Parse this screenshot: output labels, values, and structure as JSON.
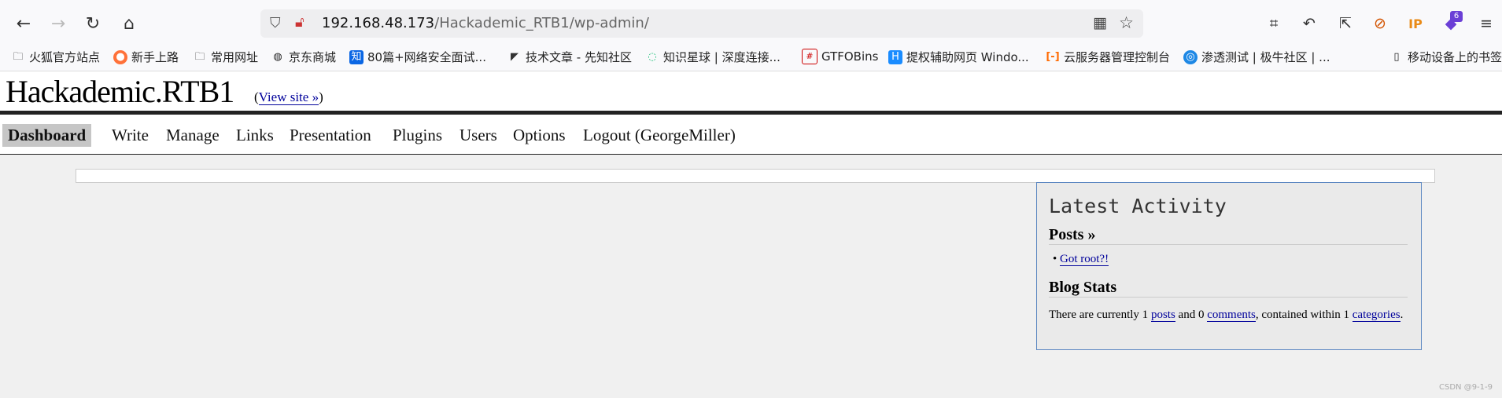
{
  "browser": {
    "url_host": "192.168.48.173",
    "url_path": "/Hackademic_RTB1/wp-admin/",
    "extension_badge": "6",
    "ip_icon_label": "IP",
    "bookmarks": [
      {
        "label": "火狐官方站点",
        "icon": "folder-icon"
      },
      {
        "label": "新手上路",
        "icon": "firefox-icon"
      },
      {
        "label": "常用网址",
        "icon": "folder-icon"
      },
      {
        "label": "京东商城",
        "icon": "globe-icon"
      },
      {
        "label": "80篇+网络安全面试...",
        "icon": "zhihu-icon"
      },
      {
        "label": "技术文章 - 先知社区",
        "icon": "xianzhi-icon"
      },
      {
        "label": "知识星球 | 深度连接...",
        "icon": "zsxq-icon"
      },
      {
        "label": "GTFOBins",
        "icon": "gtfobins-icon"
      },
      {
        "label": "提权辅助网页 Windo...",
        "icon": "h-icon"
      },
      {
        "label": "云服务器管理控制台",
        "icon": "aliyun-icon"
      },
      {
        "label": "渗透测试 | 极牛社区 | ...",
        "icon": "jiniu-icon"
      }
    ],
    "mobile_bookmarks": "移动设备上的书签"
  },
  "wp": {
    "blog_title": "Hackademic.RTB1",
    "view_site_open": "(",
    "view_site": "View site »",
    "view_site_close": ")",
    "menu": [
      "Dashboard",
      "Write",
      "Manage",
      "Links",
      "Presentation",
      "Plugins",
      "Users",
      "Options",
      "Logout (GeorgeMiller)"
    ],
    "activity": {
      "title": "Latest Activity",
      "posts_heading": "Posts »",
      "post_item": "Got root?!",
      "stats_heading": "Blog Stats",
      "stats_prefix": "There are currently 1 ",
      "posts_link": "posts",
      "stats_mid": " and 0 ",
      "comments_link": "comments",
      "stats_mid2": ", contained within 1 ",
      "categories_link": "categories",
      "stats_end": "."
    }
  },
  "watermark": "CSDN @9-1-9"
}
